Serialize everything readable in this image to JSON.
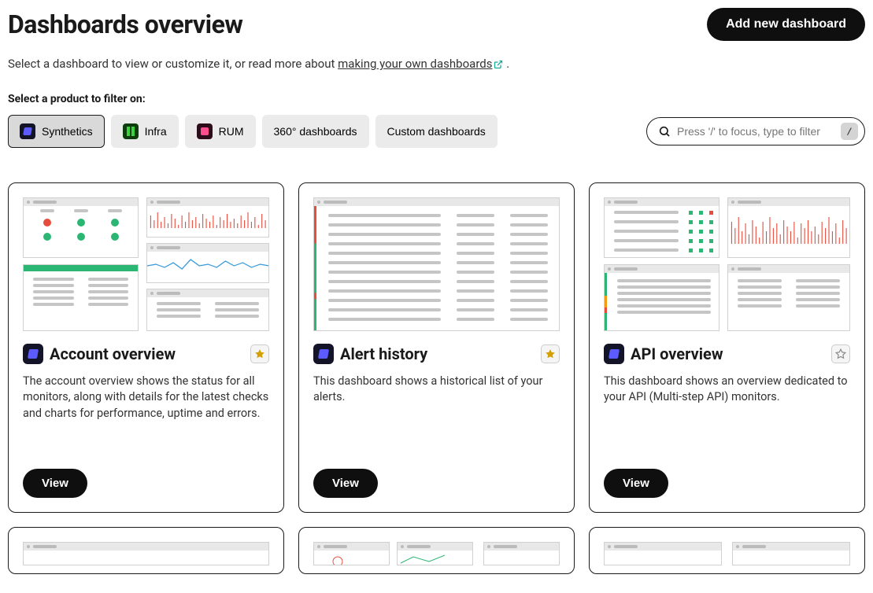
{
  "header": {
    "title": "Dashboards overview",
    "add_button": "Add new dashboard"
  },
  "intro": {
    "prefix": "Select a dashboard to view or customize it, or read more about ",
    "link": "making your own dashboards",
    "suffix": " ."
  },
  "filter": {
    "label": "Select a product to filter on:",
    "chips": [
      {
        "label": "Synthetics",
        "icon": "syn",
        "active": true
      },
      {
        "label": "Infra",
        "icon": "infra",
        "active": false
      },
      {
        "label": "RUM",
        "icon": "rum",
        "active": false
      },
      {
        "label": "360° dashboards",
        "icon": null,
        "active": false
      },
      {
        "label": "Custom dashboards",
        "icon": null,
        "active": false
      }
    ]
  },
  "search": {
    "placeholder": "Press '/' to focus, type to filter",
    "kbd": "/"
  },
  "cards": [
    {
      "title": "Account overview",
      "desc": "The account overview shows the status for all monitors, along with details for the latest checks and charts for performance, uptime and errors.",
      "favorite": true,
      "view": "View"
    },
    {
      "title": "Alert history",
      "desc": "This dashboard shows a historical list of your alerts.",
      "favorite": true,
      "view": "View"
    },
    {
      "title": "API overview",
      "desc": "This dashboard shows an overview dedicated to your API (Multi-step API) monitors.",
      "favorite": false,
      "view": "View"
    }
  ]
}
